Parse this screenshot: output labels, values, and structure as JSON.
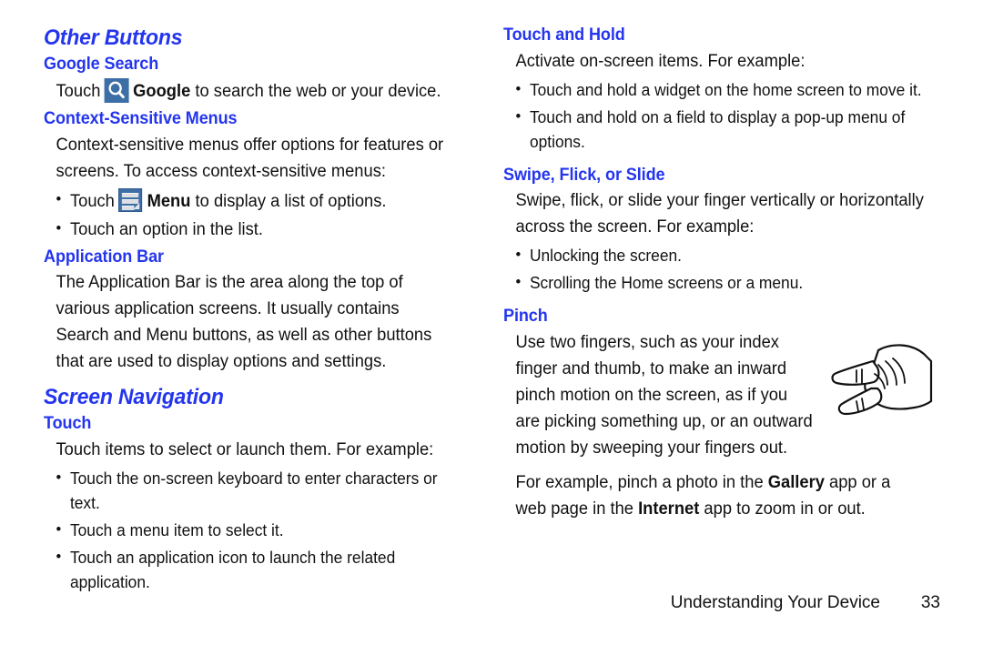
{
  "page": {
    "footer_title": "Understanding Your Device",
    "footer_page": "33",
    "heading_color": "#2435ee",
    "icon_badge_color": "#3d6fa6"
  },
  "left_column": {
    "section_title": "Other Buttons",
    "google_search": {
      "heading": "Google Search",
      "line_prefix": "Touch",
      "icon_name": "search-icon",
      "bold_word": "Google",
      "line_suffix": "to search the web or your device."
    },
    "context_menus": {
      "heading": "Context-Sensitive Menus",
      "paragraph": "Context-sensitive menus offer options for features or screens. To access context-sensitive menus:",
      "bullet_1_prefix": "Touch",
      "bullet_1_icon_name": "menu-icon",
      "bullet_1_bold": "Menu",
      "bullet_1_suffix": "to display a list of options.",
      "bullet_2": "Touch an option in the list."
    },
    "application_bar": {
      "heading": "Application Bar",
      "paragraph": "The Application Bar is the area along the top of various application screens. It usually contains Search and Menu buttons, as well as other buttons that are used to display options and settings."
    },
    "screen_navigation_title": "Screen Navigation",
    "touch": {
      "heading": "Touch",
      "paragraph": "Touch items to select or launch them. For example:",
      "bullets": [
        "Touch the on-screen keyboard to enter characters or text.",
        "Touch a menu item to select it.",
        "Touch an application icon to launch the related application."
      ]
    }
  },
  "right_column": {
    "touch_and_hold": {
      "heading": "Touch and Hold",
      "paragraph": "Activate on-screen items. For example:",
      "bullets": [
        "Touch and hold a widget on the home screen to move it.",
        "Touch and hold on a field to display a pop-up menu of options."
      ]
    },
    "swipe": {
      "heading": "Swipe, Flick, or Slide",
      "paragraph": "Swipe, flick, or slide your finger vertically or horizontally across the screen. For example:",
      "bullets": [
        "Unlocking the screen.",
        "Scrolling the Home screens or a menu."
      ]
    },
    "pinch": {
      "heading": "Pinch",
      "paragraph": "Use two fingers, such as your index finger and thumb, to make an inward pinch motion on the screen, as if you are picking something up, or an outward motion by sweeping your fingers out.",
      "illustration_name": "pinch-hand-illustration",
      "example_part1": "For example, pinch a photo in the",
      "example_bold1": "Gallery",
      "example_part2": "app or a web page in the",
      "example_bold2": "Internet",
      "example_part3": "app to zoom in or out."
    }
  }
}
